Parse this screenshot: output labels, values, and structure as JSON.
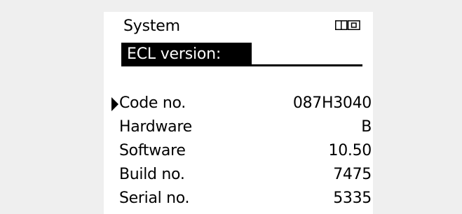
{
  "header": {
    "title": "System",
    "mode_icon": "dual-square-display-icon"
  },
  "section": {
    "title": "ECL version:"
  },
  "rows": [
    {
      "label": "Code no.",
      "value": "087H3040",
      "selected": true
    },
    {
      "label": "Hardware",
      "value": "B",
      "selected": false
    },
    {
      "label": "Software",
      "value": "10.50",
      "selected": false
    },
    {
      "label": "Build no.",
      "value": "7475",
      "selected": false
    },
    {
      "label": "Serial no.",
      "value": "5335",
      "selected": false
    }
  ],
  "colors": {
    "background": "#efefef",
    "screen": "#ffffff",
    "foreground": "#000000"
  }
}
